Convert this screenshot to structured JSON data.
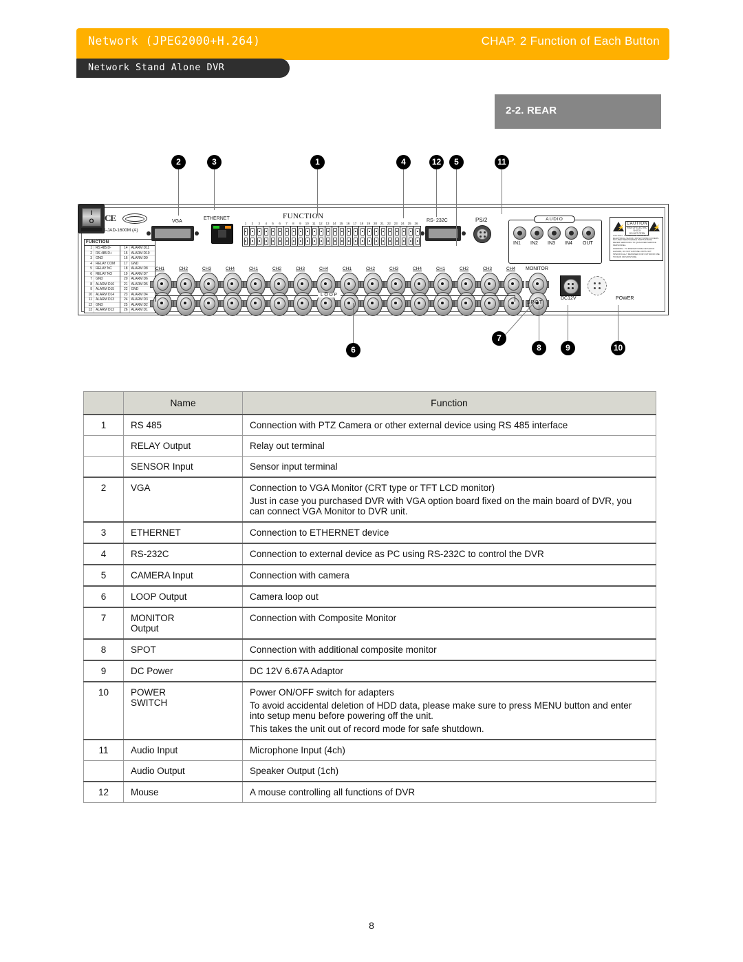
{
  "header": {
    "left_title": "Network (JPEG2000+H.264)",
    "right_title": "CHAP. 2  Function of Each Button",
    "tab_label": "Network Stand Alone DVR",
    "accent_color": "#FFB000",
    "tab_color": "#2f2f2f"
  },
  "section": {
    "badge_label": "2-2. REAR",
    "badge_color": "#868686"
  },
  "diagram": {
    "callouts": [
      {
        "id": "2",
        "label": "2"
      },
      {
        "id": "3",
        "label": "3"
      },
      {
        "id": "1",
        "label": "1"
      },
      {
        "id": "4",
        "label": "4"
      },
      {
        "id": "12",
        "label": "12"
      },
      {
        "id": "5",
        "label": "5"
      },
      {
        "id": "11",
        "label": "11"
      },
      {
        "id": "6",
        "label": "6"
      },
      {
        "id": "7",
        "label": "7"
      },
      {
        "id": "8",
        "label": "8"
      },
      {
        "id": "9",
        "label": "9"
      },
      {
        "id": "10",
        "label": "10"
      }
    ],
    "panel_labels": {
      "vga": "VGA",
      "ethernet": "ETHERNET",
      "function": "FUNCTION",
      "rs232c": "RS- 232C",
      "ps2": "PS/2",
      "audio": "AUDIO",
      "audio_in1": "IN1",
      "audio_in2": "IN2",
      "audio_in3": "IN3",
      "audio_in4": "IN4",
      "audio_out": "OUT",
      "monitor": "MONITOR",
      "spot": "SPOT",
      "dc12v": "DC12V",
      "power": "POWER",
      "loop": "LOOP",
      "mic_code": "MIC : AGS-JAD-1600M (A)",
      "fcc_mark": "FC",
      "ce_mark": "CE",
      "power_on": "I",
      "power_off": "O"
    },
    "channel_labels": [
      "CH1",
      "CH2",
      "CH3",
      "CH4",
      "CH1",
      "CH2",
      "CH3",
      "CH4",
      "CH1",
      "CH2",
      "CH3",
      "CH4",
      "CH1",
      "CH2",
      "CH3",
      "CH4"
    ],
    "function_pin_table": {
      "title": "FUNCTION",
      "left": [
        {
          "n": "1",
          "v": "RS 485  D-"
        },
        {
          "n": "2",
          "v": "RS 485  D+"
        },
        {
          "n": "3",
          "v": "GND"
        },
        {
          "n": "4",
          "v": "RELAY  COM"
        },
        {
          "n": "5",
          "v": "RELAY  NC"
        },
        {
          "n": "6",
          "v": "RELAY  NO"
        },
        {
          "n": "7",
          "v": "GND"
        },
        {
          "n": "8",
          "v": "ALARM  D16"
        },
        {
          "n": "9",
          "v": "ALARM  D15"
        },
        {
          "n": "10",
          "v": "ALARM  D14"
        },
        {
          "n": "11",
          "v": "ALARM  D13"
        },
        {
          "n": "12",
          "v": "GND"
        },
        {
          "n": "13",
          "v": "ALARM  D12"
        }
      ],
      "right": [
        {
          "n": "14",
          "v": "ALARM  D11"
        },
        {
          "n": "15",
          "v": "ALARM  D10"
        },
        {
          "n": "16",
          "v": "ALARM  D9"
        },
        {
          "n": "17",
          "v": "GND"
        },
        {
          "n": "18",
          "v": "ALARM  D8"
        },
        {
          "n": "19",
          "v": "ALARM  D7"
        },
        {
          "n": "20",
          "v": "ALARM  D6"
        },
        {
          "n": "21",
          "v": "ALARM  D5"
        },
        {
          "n": "22",
          "v": "GND"
        },
        {
          "n": "23",
          "v": "ALARM  D4"
        },
        {
          "n": "24",
          "v": "ALARM  D3"
        },
        {
          "n": "25",
          "v": "ALARM  D2"
        },
        {
          "n": "26",
          "v": "ALARM  D1"
        }
      ]
    },
    "terminal_numbers": [
      "1",
      "2",
      "3",
      "4",
      "5",
      "6",
      "7",
      "8",
      "9",
      "10",
      "11",
      "12",
      "13",
      "14",
      "15",
      "16",
      "17",
      "18",
      "19",
      "20",
      "21",
      "22",
      "23",
      "24",
      "25",
      "26"
    ],
    "caution": {
      "title": "CAUTION",
      "subtitle": "RISK OF ELECTRIC SHOCK",
      "subtitle2": "DO NOT OPEN",
      "line1": "CAUTION : TO REDUCE THE RISK OF ELECTRICAL SHOCK, DO NOT OPEN COVERS.",
      "line2": "NO USER SERVICEABLE PARTS INSIDE. REFER SERVICING TO QUALIFIED SERVICE PERSONNEL.",
      "line3": "WARNING : TO PREVENT FIRE OR SHOCK HAZARD, DO NOT EXPOSE UNITS NOT SPECIFICALLY DESIGNED FOR OUTDOOR USE TO RAIN OR MOISTURE."
    }
  },
  "table": {
    "columns": [
      "",
      "Name",
      "Function"
    ],
    "rows": [
      {
        "num": "1",
        "name": "RS 485",
        "lines": [
          "Connection with PTZ Camera or other external device using RS 485 interface"
        ],
        "group_start": true
      },
      {
        "num": "",
        "name": "RELAY Output",
        "lines": [
          "Relay out terminal"
        ],
        "group_start": false
      },
      {
        "num": "",
        "name": "SENSOR Input",
        "lines": [
          "Sensor input terminal"
        ],
        "group_start": false
      },
      {
        "num": "2",
        "name": "VGA",
        "lines": [
          "Connection to VGA Monitor (CRT type or TFT LCD monitor)",
          "Just in case you purchased DVR with VGA option board fixed on the main board of DVR, you can connect VGA Monitor to DVR unit."
        ],
        "group_start": true
      },
      {
        "num": "3",
        "name": "ETHERNET",
        "lines": [
          "Connection to ETHERNET device"
        ],
        "group_start": true
      },
      {
        "num": "4",
        "name": "RS-232C",
        "lines": [
          "Connection to external device as PC using RS-232C to control the DVR"
        ],
        "group_start": true
      },
      {
        "num": "5",
        "name": "CAMERA Input",
        "lines": [
          "Connection with camera"
        ],
        "group_start": true
      },
      {
        "num": "6",
        "name": "LOOP Output",
        "lines": [
          "Camera loop out"
        ],
        "group_start": true
      },
      {
        "num": "7",
        "name": "MONITOR\nOutput",
        "lines": [
          "Connection with Composite Monitor"
        ],
        "group_start": true
      },
      {
        "num": "8",
        "name": "SPOT",
        "lines": [
          "Connection with additional composite monitor"
        ],
        "group_start": true
      },
      {
        "num": "9",
        "name": "DC Power",
        "lines": [
          "DC 12V 6.67A Adaptor"
        ],
        "group_start": true
      },
      {
        "num": "10",
        "name": "POWER\nSWITCH",
        "lines": [
          "Power ON/OFF switch for adapters",
          "To avoid accidental deletion of HDD data, please make sure to press MENU button and enter into setup menu before powering off the unit.",
          "This takes the unit out of record mode for safe shutdown."
        ],
        "group_start": true
      },
      {
        "num": "11",
        "name": "Audio Input",
        "lines": [
          "Microphone Input (4ch)"
        ],
        "group_start": true
      },
      {
        "num": "",
        "name": "Audio Output",
        "lines": [
          "Speaker Output (1ch)"
        ],
        "group_start": false
      },
      {
        "num": "12",
        "name": "Mouse",
        "lines": [
          "A mouse controlling all functions of DVR"
        ],
        "group_start": true
      }
    ]
  },
  "footer": {
    "page_number": "8"
  }
}
